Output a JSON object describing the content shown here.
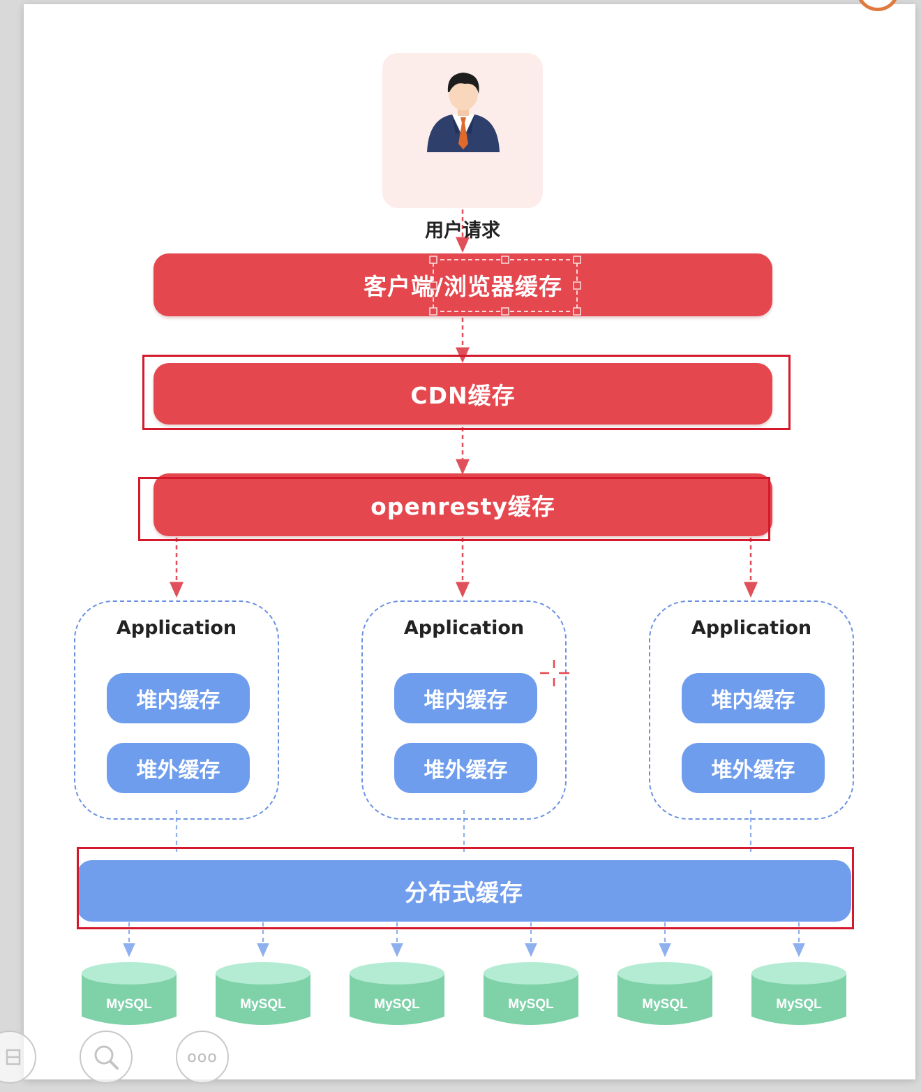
{
  "diagram": {
    "user": {
      "label": "用户请求",
      "icon": "businessman-icon"
    },
    "layers": {
      "client_browser": "客户端/浏览器缓存",
      "cdn": "CDN缓存",
      "openresty": "openresty缓存",
      "distributed": "分布式缓存"
    },
    "applications": [
      {
        "title": "Application",
        "on_heap": "堆内缓存",
        "off_heap": "堆外缓存"
      },
      {
        "title": "Application",
        "on_heap": "堆内缓存",
        "off_heap": "堆外缓存"
      },
      {
        "title": "Application",
        "on_heap": "堆内缓存",
        "off_heap": "堆外缓存"
      }
    ],
    "databases": [
      "MySQL",
      "MySQL",
      "MySQL",
      "MySQL",
      "MySQL",
      "MySQL"
    ]
  },
  "colors": {
    "red_bar": "#e5474e",
    "blue_bar": "#719ded",
    "highlight_frame": "#d3192b",
    "db_top": "#b3ecd3",
    "db_body": "#7fd1a8"
  },
  "toolbar": {
    "icons": [
      "layout-icon",
      "search-zoom-icon",
      "more-options-icon"
    ],
    "more_label": "ooo"
  }
}
